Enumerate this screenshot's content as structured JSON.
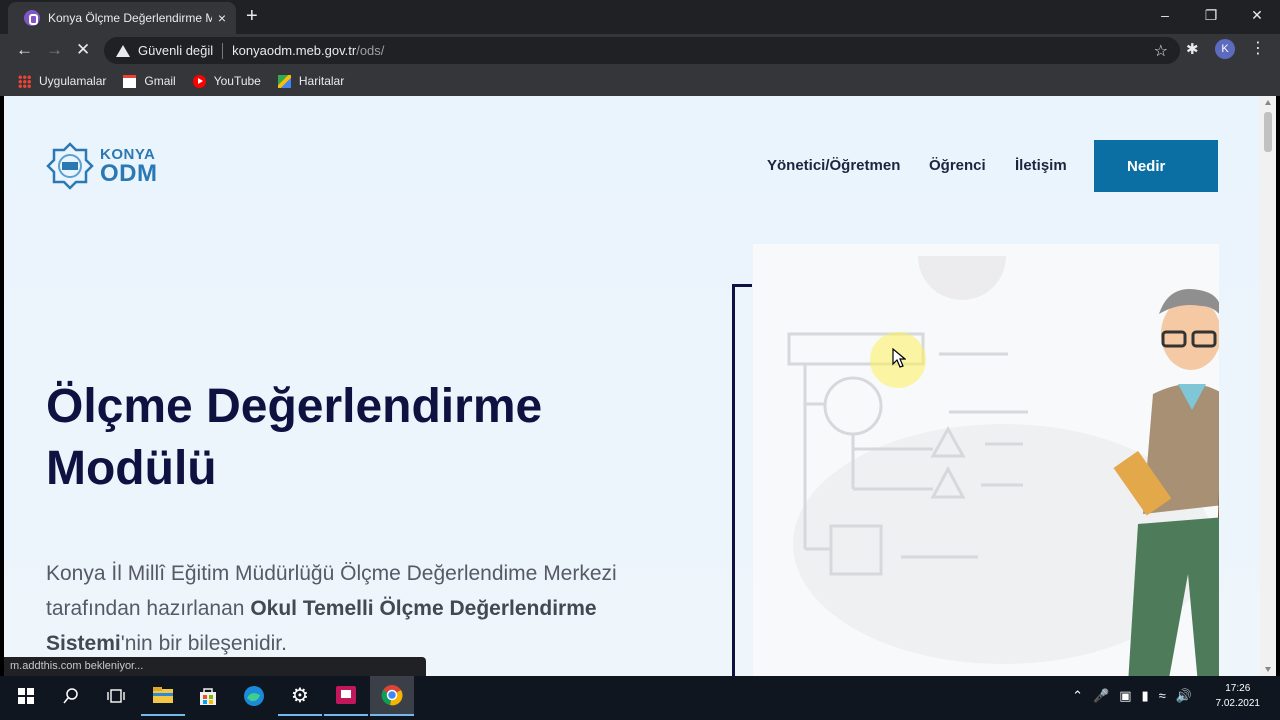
{
  "browser": {
    "tab_title": "Konya Ölçme Değerlendirme Mo",
    "tab_close": "×",
    "new_tab": "+",
    "window_controls": [
      "–",
      "❐",
      "✕"
    ],
    "security_label": "Güvenli değil",
    "url_host": "konyaodm.meb.gov.tr",
    "url_path": "/ods/",
    "profile_initial": "K",
    "bookmarks": [
      {
        "label": "Uygulamalar",
        "icon": "apps-grid-icon"
      },
      {
        "label": "Gmail",
        "icon": "gmail-icon"
      },
      {
        "label": "YouTube",
        "icon": "youtube-icon"
      },
      {
        "label": "Haritalar",
        "icon": "maps-icon"
      }
    ],
    "status_text": "m.addthis.com bekleniyor..."
  },
  "site": {
    "logo": {
      "line1": "KONYA",
      "line2": "ODM"
    },
    "nav": {
      "teacher": "Yönetici/Öğretmen",
      "student": "Öğrenci",
      "contact": "İletişim",
      "cta": "Nedir"
    },
    "hero": {
      "title": "Ölçme Değerlendirme Modülü",
      "text_before": "Konya İl Millî Eğitim Müdürlüğü Ölçme Değerlendime Merkezi tarafından hazırlanan ",
      "text_bold": "Okul Temelli Ölçme Değerlendirme Sistemi",
      "text_after": "'nin bir bileşenidir."
    }
  },
  "taskbar": {
    "clock_time": "17:26",
    "clock_date": "7.02.2021"
  },
  "colors": {
    "brand_blue": "#0b6fa4",
    "heading_navy": "#0e1240",
    "page_bg": "#eaf4fd"
  }
}
